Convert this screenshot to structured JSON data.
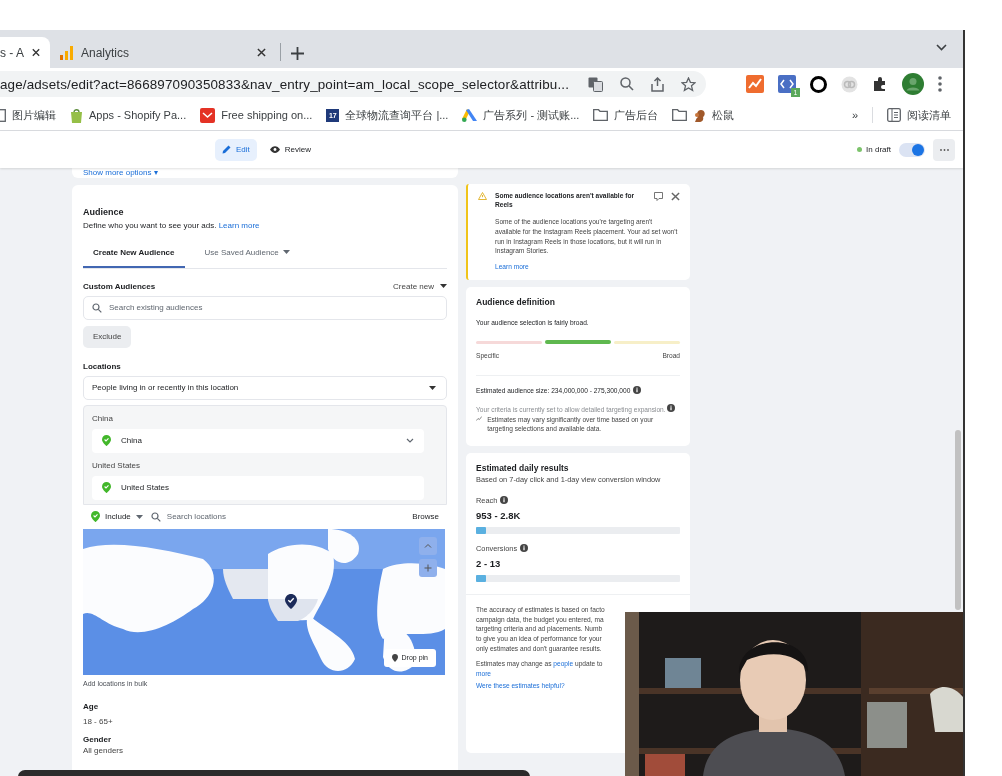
{
  "browser": {
    "tabs": [
      {
        "title": "s - A",
        "kind": "plain",
        "selected": true
      },
      {
        "title": "Analytics",
        "kind": "analytics",
        "selected": false
      }
    ],
    "address": "age/adsets/edit?act=866897090350833&nav_entry_point=am_local_scope_selector&attribu...",
    "extensions": [
      {
        "kind": "chart"
      },
      {
        "kind": "code",
        "badge": "1"
      },
      {
        "kind": "ring"
      },
      {
        "kind": "link"
      },
      {
        "kind": "puzzle"
      },
      {
        "kind": "avatar"
      }
    ],
    "bookmarks": [
      {
        "kind": "page",
        "label": "图片编辑"
      },
      {
        "kind": "bag",
        "label": "Apps - Shopify Pa..."
      },
      {
        "kind": "mail",
        "label": "Free shipping on..."
      },
      {
        "kind": "numbered",
        "icon_text": "17",
        "label": "全球物流查询平台 |..."
      },
      {
        "kind": "ads",
        "label": "广告系列 - 测试账..."
      },
      {
        "kind": "folder",
        "label": "广告后台"
      },
      {
        "kind": "folder-squirrel",
        "label": "松鼠"
      }
    ],
    "bookmarks_more": "»",
    "reading_list": "阅读清单"
  },
  "toolbar": {
    "tabs": [
      {
        "label": "Edit",
        "kind": "edit",
        "selected": true
      },
      {
        "label": "Review",
        "kind": "review",
        "selected": false
      }
    ],
    "status": {
      "label": "In draft",
      "color": "#7cc36b"
    },
    "toggle": {
      "on": true
    }
  },
  "ad_set": {
    "show_more": "Show more options ▾"
  },
  "audience": {
    "title": "Audience",
    "description": "Define who you want to see your ads.",
    "learn_more": "Learn more",
    "tabs": [
      {
        "label": "Create New Audience",
        "selected": true,
        "dropdown": false
      },
      {
        "label": "Use Saved Audience",
        "selected": false,
        "dropdown": true
      }
    ],
    "custom_audiences": {
      "label": "Custom Audiences",
      "create_new": "Create new",
      "placeholder": "Search existing audiences",
      "exclude": "Exclude"
    },
    "locations": {
      "label": "Locations",
      "mode": "People living in or recently in this location",
      "groups": [
        {
          "heading": "China",
          "location": "China",
          "hovered": true
        },
        {
          "heading": "United States",
          "location": "United States",
          "hovered": false
        }
      ],
      "include": "Include",
      "search_placeholder": "Search locations",
      "browse": "Browse",
      "drop_pin": "Drop pin",
      "bulk": "Add locations in bulk"
    },
    "age": {
      "label": "Age",
      "value": "18 - 65+"
    },
    "gender": {
      "label": "Gender",
      "value": "All genders"
    }
  },
  "notice": {
    "title": "Some audience locations aren't available for Reels",
    "body": "Some of the audience locations you're targeting aren't available for the Instagram Reels placement. Your ad set won't run in Instagram Reels in those locations, but it will run in Instagram Stories.",
    "learn_more": "Learn more"
  },
  "definition": {
    "title": "Audience definition",
    "summary": "Your audience selection is fairly broad.",
    "segments": [
      {
        "color": "#f6d9d9",
        "selected": false
      },
      {
        "color": "#5fb84f",
        "selected": true
      },
      {
        "color": "#f7efc8",
        "selected": false
      }
    ],
    "low": "Specific",
    "high": "Broad",
    "size": "Estimated audience size: 234,000,000 - 275,300,000",
    "criteria": "Your criteria is currently set to allow detailed targeting expansion.",
    "note": "Estimates may vary significantly over time based on your targeting selections and available data."
  },
  "results": {
    "title": "Estimated daily results",
    "subtitle": "Based on 7-day click and 1-day view conversion window",
    "metrics": [
      {
        "label": "Reach",
        "value": "953 - 2.8K",
        "level": 0.05
      },
      {
        "label": "Conversions",
        "value": "2 - 13",
        "level": 0.05
      }
    ],
    "accuracy_lines": [
      "The accuracy of estimates is based on facto",
      "campaign data, the budget you entered, ma",
      "targeting criteria and ad placements. Numb",
      "to give you an idea of performance for your",
      "only estimates and don't guarantee results."
    ],
    "change_note": {
      "before": "Estimates may change as ",
      "link": "people",
      "after": " update to"
    },
    "more": "more",
    "feedback": "Were these estimates helpful?"
  }
}
